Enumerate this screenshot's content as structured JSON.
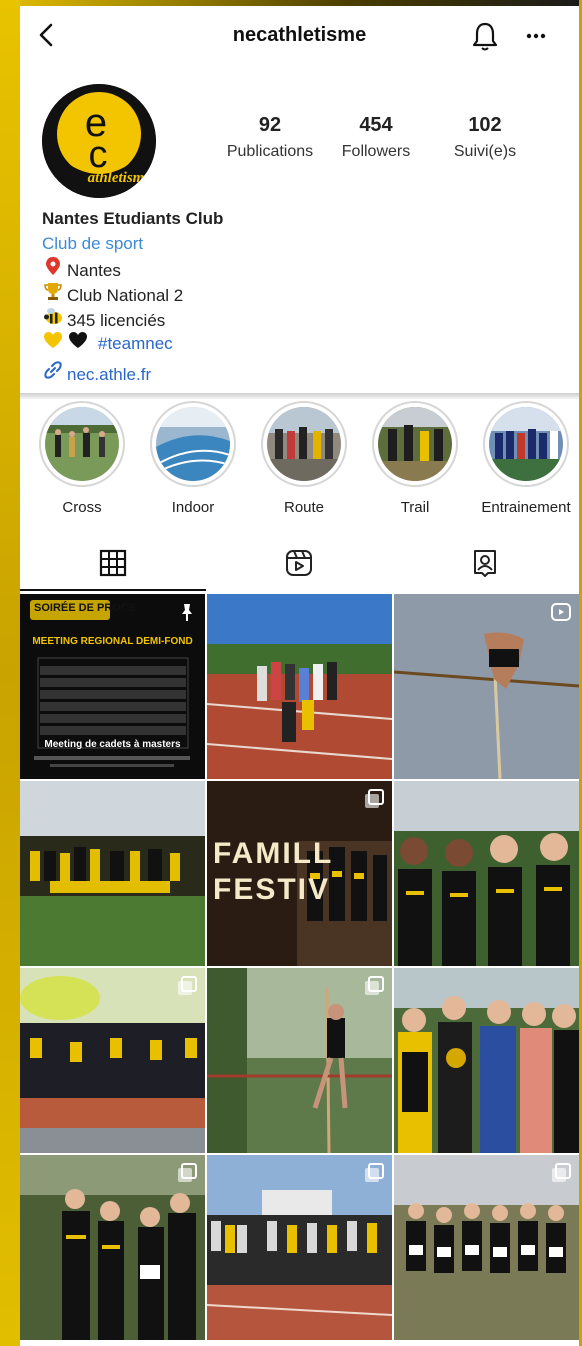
{
  "header": {
    "username": "necathletisme"
  },
  "profile": {
    "avatar_lettering": "ec athletism",
    "stats": [
      {
        "value": "92",
        "label": "Publications"
      },
      {
        "value": "454",
        "label": "Followers"
      },
      {
        "value": "102",
        "label": "Suivi(e)s"
      }
    ],
    "name": "Nantes Etudiants Club",
    "category": "Club de sport",
    "bio": {
      "location": "Nantes",
      "level": "Club National 2",
      "members": "345 licenciés",
      "hashtag": "#teamnec"
    },
    "link": "nec.athle.fr"
  },
  "highlights": [
    {
      "label": "Cross"
    },
    {
      "label": "Indoor"
    },
    {
      "label": "Route"
    },
    {
      "label": "Trail"
    },
    {
      "label": "Entrainement"
    }
  ],
  "tabs": [
    "grid-icon",
    "reels-icon",
    "tagged-icon"
  ],
  "posts": {
    "post1": {
      "badge": "SOIRÉE DE PROCE",
      "title": "MEETING REGIONAL DEMI-FOND",
      "subtitle": "Meeting de cadets à masters"
    },
    "post5": {
      "title_line1": "FAMILL",
      "title_line2": "FESTIV"
    }
  },
  "colors": {
    "brand_yellow": "#f2c500",
    "link_blue": "#2a66c9",
    "category_blue": "#3c8ad6"
  }
}
